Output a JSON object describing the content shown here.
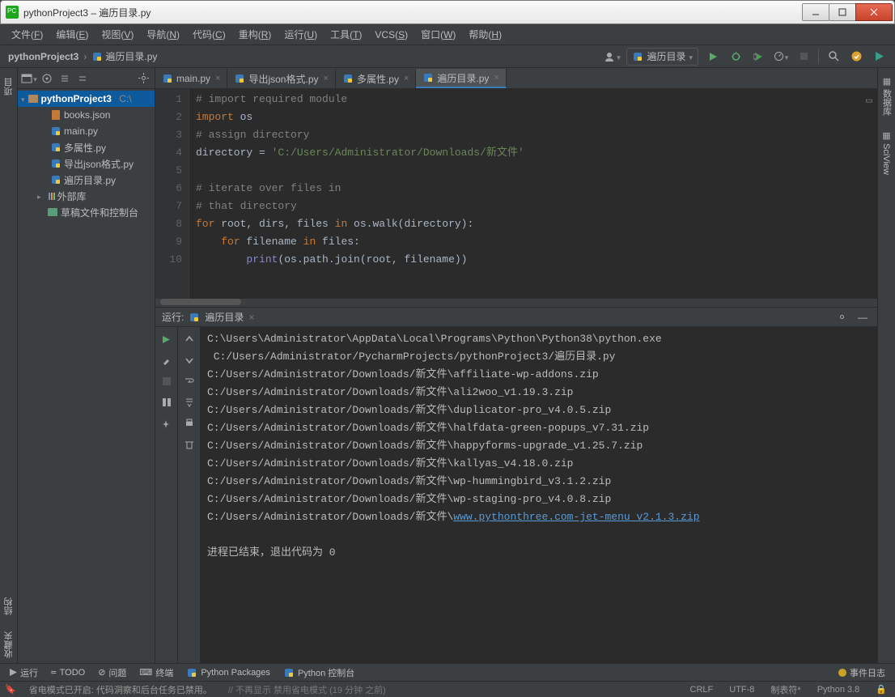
{
  "window": {
    "title": "pythonProject3 – 遍历目录.py"
  },
  "menu": [
    "文件(F)",
    "编辑(E)",
    "视图(V)",
    "导航(N)",
    "代码(C)",
    "重构(R)",
    "运行(U)",
    "工具(T)",
    "VCS(S)",
    "窗口(W)",
    "帮助(H)"
  ],
  "breadcrumb": {
    "project": "pythonProject3",
    "file": "遍历目录.py"
  },
  "run_config": "遍历目录",
  "left_rail": {
    "label": "项目"
  },
  "right_rail": {
    "label1": "数据库",
    "label2": "SciView"
  },
  "tree": {
    "root": "pythonProject3",
    "root_suffix": "C:\\",
    "files": [
      "books.json",
      "main.py",
      "多属性.py",
      "导出json格式.py",
      "遍历目录.py"
    ],
    "external": "外部库",
    "scratches": "草稿文件和控制台"
  },
  "tabs": [
    {
      "label": "main.py",
      "active": false
    },
    {
      "label": "导出json格式.py",
      "active": false
    },
    {
      "label": "多属性.py",
      "active": false
    },
    {
      "label": "遍历目录.py",
      "active": true
    }
  ],
  "gutter_lines": [
    "1",
    "2",
    "3",
    "4",
    "5",
    "6",
    "7",
    "8",
    "9",
    "10"
  ],
  "code_lines": [
    {
      "t": "# import required module",
      "cls": "cm-comment"
    },
    {
      "raw": "<span class='cm-kw'>import</span> os"
    },
    {
      "t": "# assign directory",
      "cls": "cm-comment"
    },
    {
      "raw": "directory = <span class='cm-str'>'C:/Users/Administrator/Downloads/新文件'</span>"
    },
    {
      "t": ""
    },
    {
      "t": "# iterate over files in",
      "cls": "cm-comment"
    },
    {
      "t": "# that directory",
      "cls": "cm-comment"
    },
    {
      "raw": "<span class='cm-kw'>for</span> root, dirs, files <span class='cm-kw'>in</span> os.walk(directory):"
    },
    {
      "raw": "    <span class='cm-kw'>for</span> filename <span class='cm-kw'>in</span> files:"
    },
    {
      "raw": "        <span class='cm-builtin'>print</span>(os.path.join(root, filename))"
    }
  ],
  "console": {
    "header_label": "运行:",
    "tab": "遍历目录",
    "output": [
      "C:\\Users\\Administrator\\AppData\\Local\\Programs\\Python\\Python38\\python.exe",
      " C:/Users/Administrator/PycharmProjects/pythonProject3/遍历目录.py",
      "C:/Users/Administrator/Downloads/新文件\\affiliate-wp-addons.zip",
      "C:/Users/Administrator/Downloads/新文件\\ali2woo_v1.19.3.zip",
      "C:/Users/Administrator/Downloads/新文件\\duplicator-pro_v4.0.5.zip",
      "C:/Users/Administrator/Downloads/新文件\\halfdata-green-popups_v7.31.zip",
      "C:/Users/Administrator/Downloads/新文件\\happyforms-upgrade_v1.25.7.zip",
      "C:/Users/Administrator/Downloads/新文件\\kallyas_v4.18.0.zip",
      "C:/Users/Administrator/Downloads/新文件\\wp-hummingbird_v3.1.2.zip",
      "C:/Users/Administrator/Downloads/新文件\\wp-staging-pro_v4.0.8.zip"
    ],
    "output_link_prefix": "C:/Users/Administrator/Downloads/新文件\\",
    "output_link": "www.pythonthree.com-jet-menu_v2.1.3.zip",
    "exit": "进程已结束，退出代码为 0"
  },
  "left_bottom_rail": {
    "label1": "结构",
    "label2": "收藏夹"
  },
  "bottombar": {
    "run": "运行",
    "todo": "TODO",
    "problems": "问题",
    "terminal": "终端",
    "pypkg": "Python Packages",
    "pyconsole": "Python 控制台",
    "eventlog": "事件日志"
  },
  "statusbar": {
    "msg": "省电模式已开启: 代码洞察和后台任务已禁用。",
    "links": "// 不再显示   禁用省电模式 (19 分钟 之前)",
    "crlf": "CRLF",
    "enc": "UTF-8",
    "indent": "制表符*",
    "py": "Python 3.8"
  }
}
